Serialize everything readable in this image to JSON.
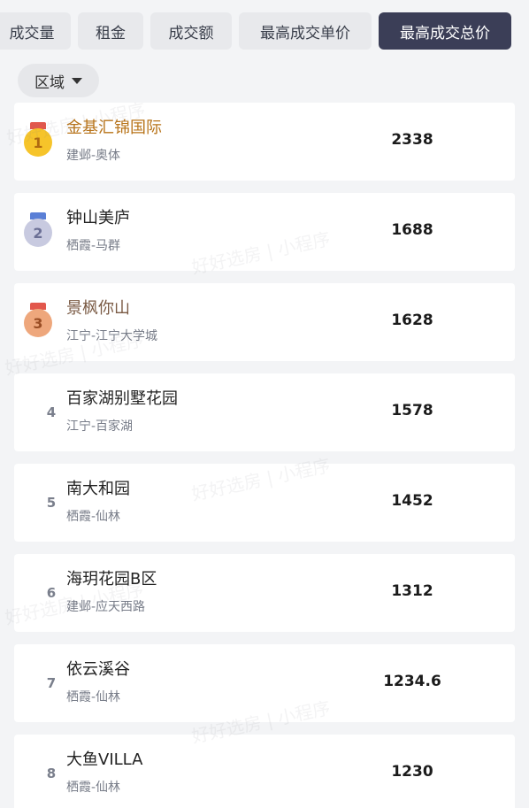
{
  "tabs": [
    "成交量",
    "租金",
    "成交额",
    "最高成交单价",
    "最高成交总价"
  ],
  "active_tab": "最高成交总价",
  "filter": {
    "label": "区域"
  },
  "watermark": "好好选房 | 小程序",
  "colors": {
    "active_tab_bg": "#3b3e57",
    "gold": "#b8741a",
    "silver": "#b9bcd6",
    "bronze": "#e8a27a"
  },
  "rows": [
    {
      "rank": "1",
      "name": "金基汇锦国际",
      "area": "建邺-奥体",
      "value": "2338"
    },
    {
      "rank": "2",
      "name": "钟山美庐",
      "area": "栖霞-马群",
      "value": "1688"
    },
    {
      "rank": "3",
      "name": "景枫你山",
      "area": "江宁-江宁大学城",
      "value": "1628"
    },
    {
      "rank": "4",
      "name": "百家湖别墅花园",
      "area": "江宁-百家湖",
      "value": "1578"
    },
    {
      "rank": "5",
      "name": "南大和园",
      "area": "栖霞-仙林",
      "value": "1452"
    },
    {
      "rank": "6",
      "name": "海玥花园B区",
      "area": "建邺-应天西路",
      "value": "1312"
    },
    {
      "rank": "7",
      "name": "依云溪谷",
      "area": "栖霞-仙林",
      "value": "1234.6"
    },
    {
      "rank": "8",
      "name": "大鱼VILLA",
      "area": "栖霞-仙林",
      "value": "1230"
    }
  ]
}
